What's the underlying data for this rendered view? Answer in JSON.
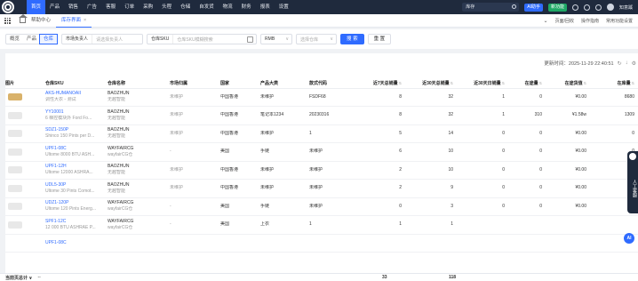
{
  "topbar": {
    "nav": [
      "首页",
      "产品",
      "销售",
      "广告",
      "客服",
      "订单",
      "采购",
      "头程",
      "仓储",
      "自发货",
      "物流",
      "财务",
      "报表",
      "设置"
    ],
    "active_nav": 0,
    "search_value": "库存",
    "ai_label": "AI助手",
    "new_label": "新功能",
    "user_name": "知意蹊"
  },
  "tabbar": {
    "tabs": [
      {
        "label": "帮助中心",
        "active": false
      },
      {
        "label": "库存界面",
        "active": true
      }
    ],
    "close_label": "×",
    "right_links": [
      "页面/回收",
      "操作指南",
      "常用功能设置"
    ]
  },
  "filters": {
    "segments": [
      "概览",
      "产品",
      "仓库"
    ],
    "active_segment": 2,
    "market_owner_label": "市场负责人",
    "market_owner_placeholder": "请选择负责人",
    "sku_label": "仓库SKU",
    "sku_placeholder": "仓库SKU模糊搜索",
    "currency": "RMB",
    "warehouse_placeholder": "选择仓库",
    "search_button": "搜 索",
    "reset_button": "重 置"
  },
  "panel": {
    "update_time": "更新时间：2025-11-29 22:40:51"
  },
  "table": {
    "columns": [
      "图片",
      "仓库SKU",
      "仓库名称",
      "市场归属",
      "国家",
      "产品大类",
      "款式代码",
      "近7天总销量",
      "近30天总销量",
      "近30天日销量",
      "在途量",
      "在途货值",
      "在库量"
    ],
    "rows": [
      {
        "sku": "AKS-HUMANOAII",
        "sku_desc": "调性大衣 - 测试",
        "wh": "BAOZHUN",
        "wh_sub": "无越智能",
        "market": "未维护",
        "country": "中国香港",
        "cat": "未维护",
        "style": "FSDF68",
        "s7": "8",
        "s30": "32",
        "d30": "1",
        "transit": "0",
        "transit_val": "¥0.00",
        "stock": "8680",
        "thumb": "gold"
      },
      {
        "sku": "YY10001",
        "sku_desc": "6 梯控模块外 Ford Fo...",
        "wh": "BAOZHUN",
        "wh_sub": "无越智能",
        "market": "未维护",
        "country": "中国香港",
        "cat": "笔记本1234",
        "style": "20230316",
        "s7": "8",
        "s30": "32",
        "d30": "1",
        "transit": "310",
        "transit_val": "¥1.58w",
        "stock": "1309",
        "thumb": "grey"
      },
      {
        "sku": "SDZ1-150P",
        "sku_desc": "Shinco 150 Pints per D...",
        "wh": "BAOZHUN",
        "wh_sub": "无越智能",
        "market": "未维护",
        "country": "中国香港",
        "cat": "未维护",
        "style": "1",
        "s7": "5",
        "s30": "14",
        "d30": "0",
        "transit": "0",
        "transit_val": "¥0.00",
        "stock": "0",
        "thumb": "grey"
      },
      {
        "sku": "UPF1-08C",
        "sku_desc": "Ultome 8000 BTU ASH...",
        "wh": "WAYFAIRCG",
        "wh_sub": "wayfairCG仓",
        "market": "-",
        "country": "美国",
        "cat": "手链",
        "style": "未维护",
        "s7": "6",
        "s30": "10",
        "d30": "0",
        "transit": "0",
        "transit_val": "¥0.00",
        "stock": "0",
        "thumb": "grey"
      },
      {
        "sku": "UPF1-12H",
        "sku_desc": "Ultome 12000 ASHRA...",
        "wh": "BAOZHUN",
        "wh_sub": "无越智能",
        "market": "未维护",
        "country": "中国香港",
        "cat": "未维护",
        "style": "未维护",
        "s7": "2",
        "s30": "10",
        "d30": "0",
        "transit": "0",
        "transit_val": "¥0.00",
        "stock": "0",
        "thumb": "grey"
      },
      {
        "sku": "UDL5-30P",
        "sku_desc": "Ultome 30 Pints Comot...",
        "wh": "BAOZHUN",
        "wh_sub": "无越智能",
        "market": "未维护",
        "country": "中国香港",
        "cat": "未维护",
        "style": "未维护",
        "s7": "2",
        "s30": "9",
        "d30": "0",
        "transit": "0",
        "transit_val": "¥0.00",
        "stock": "0",
        "thumb": "grey"
      },
      {
        "sku": "UDZ1-120P",
        "sku_desc": "Ultome 120 Pints Energ...",
        "wh": "WAYFAIRCG",
        "wh_sub": "wayfairCG仓",
        "market": "-",
        "country": "美国",
        "cat": "手链",
        "style": "未维护",
        "s7": "0",
        "s30": "3",
        "d30": "0",
        "transit": "0",
        "transit_val": "¥0.00",
        "stock": "0",
        "thumb": "grey"
      },
      {
        "sku": "SPF1-12C",
        "sku_desc": "12 000 BTU ASHRAE P...",
        "wh": "WAYFAIRCG",
        "wh_sub": "wayfairCG仓",
        "market": "-",
        "country": "美国",
        "cat": "上衣",
        "style": "1",
        "s7": "1",
        "s30": "1",
        "d30": "",
        "transit": "",
        "transit_val": "",
        "stock": "",
        "thumb": "grey"
      },
      {
        "sku": "UPF1-08C",
        "sku_desc": "",
        "wh": "",
        "wh_sub": "",
        "market": "",
        "country": "",
        "cat": "",
        "style": "",
        "s7": "",
        "s30": "",
        "d30": "",
        "transit": "",
        "transit_val": "",
        "stock": "",
        "thumb": "none"
      }
    ]
  },
  "footer": {
    "label": "当前页总计 ∨",
    "dash": "--",
    "sum7": "33",
    "sum30": "118"
  },
  "side": {
    "service_label": "人工客服",
    "ai_label": "AI"
  }
}
